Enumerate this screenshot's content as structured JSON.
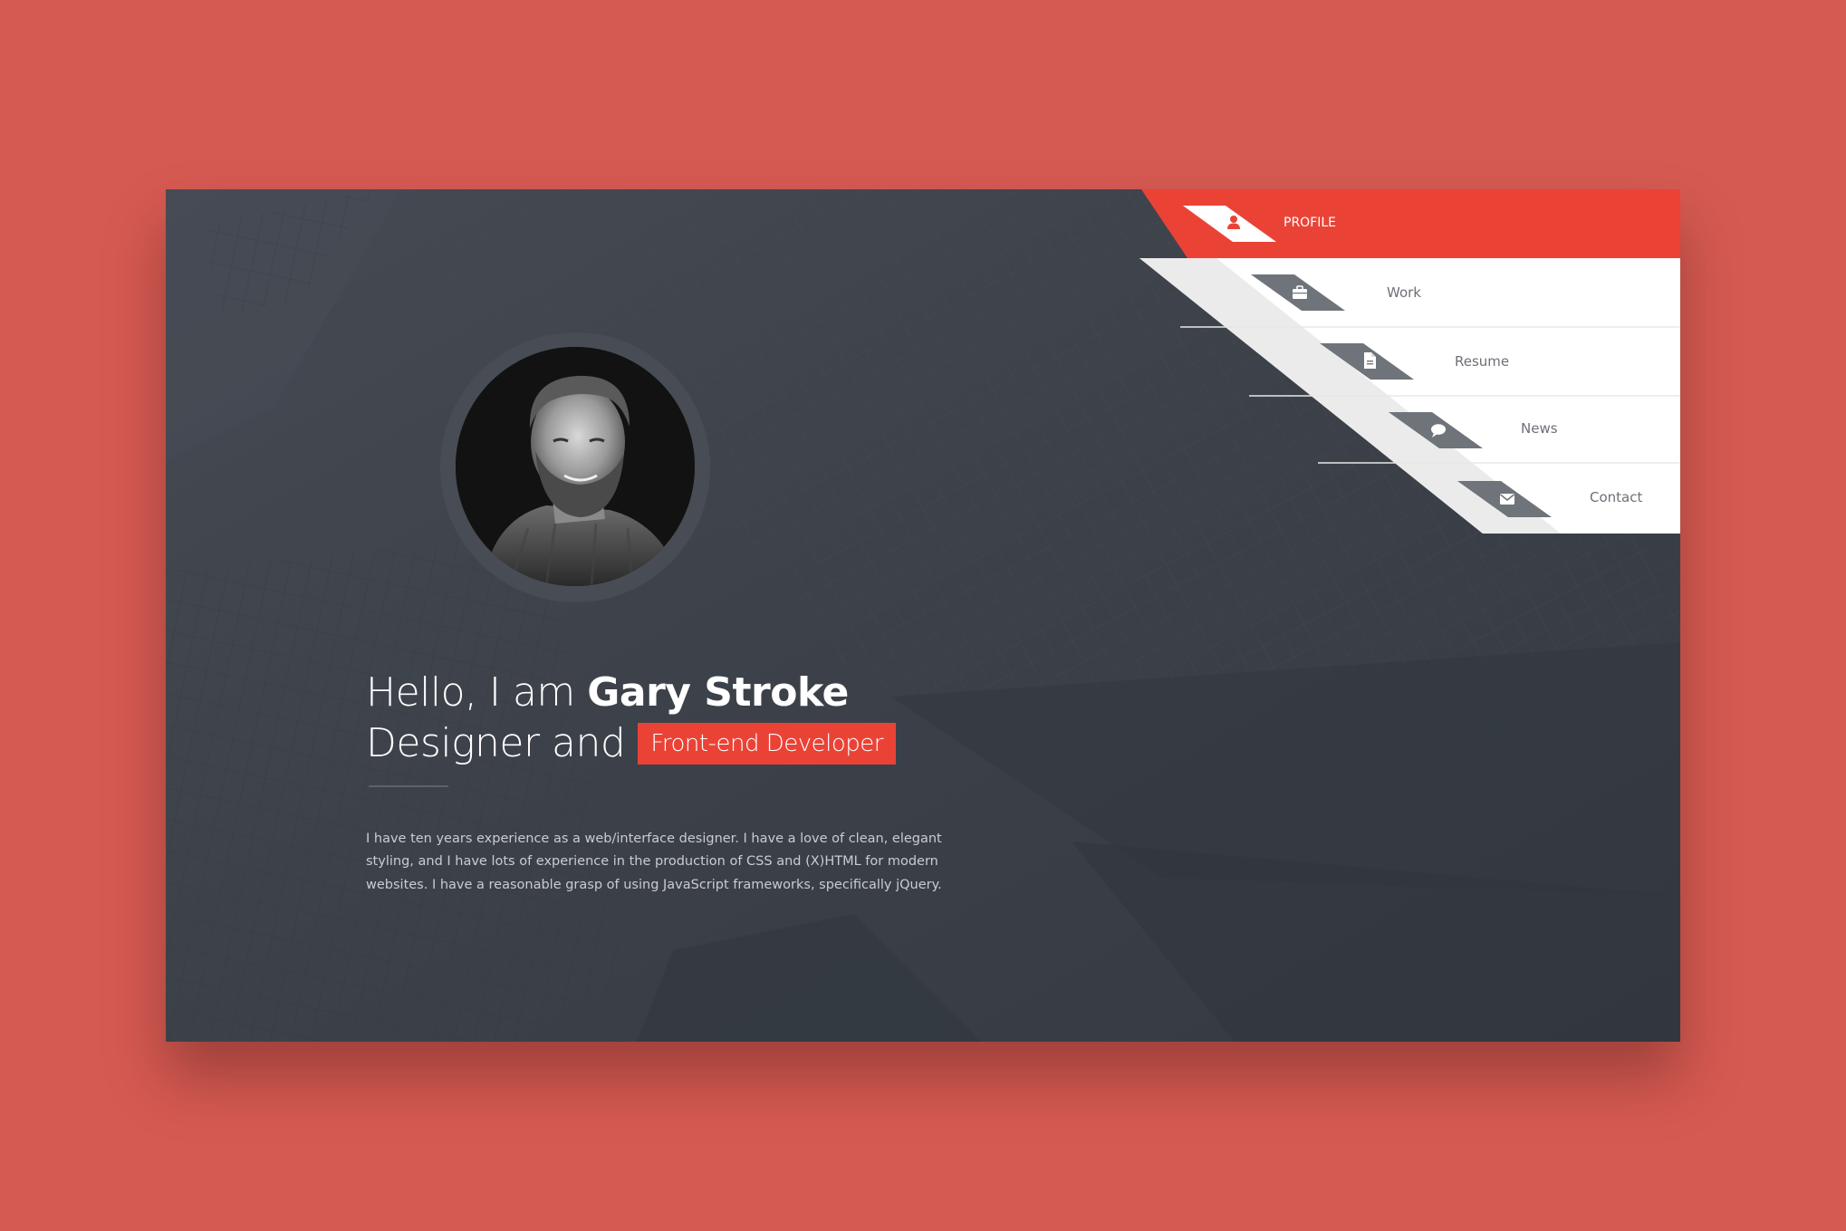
{
  "nav": {
    "items": [
      {
        "label": "PROFILE",
        "icon": "user-icon",
        "active": true
      },
      {
        "label": "Work",
        "icon": "briefcase-icon",
        "active": false
      },
      {
        "label": "Resume",
        "icon": "document-icon",
        "active": false
      },
      {
        "label": "News",
        "icon": "speech-bubble-icon",
        "active": false
      },
      {
        "label": "Contact",
        "icon": "envelope-icon",
        "active": false
      }
    ]
  },
  "hero": {
    "greeting": "Hello, I am",
    "name": "Gary Stroke",
    "role_prefix": "Designer and",
    "role_highlight": "Front-end Developer",
    "bio": "I have ten years experience as a web/interface designer. I have a love of clean, elegant styling, and I have lots of experience in the production of CSS and (X)HTML for modern websites. I have a reasonable grasp of using JavaScript frameworks, specifically jQuery."
  },
  "colors": {
    "page_background": "#d55a52",
    "card_background": "#3b4049",
    "accent": "#ea4336",
    "nav_background": "#ffffff",
    "nav_icon_tab": "#6f747b"
  }
}
